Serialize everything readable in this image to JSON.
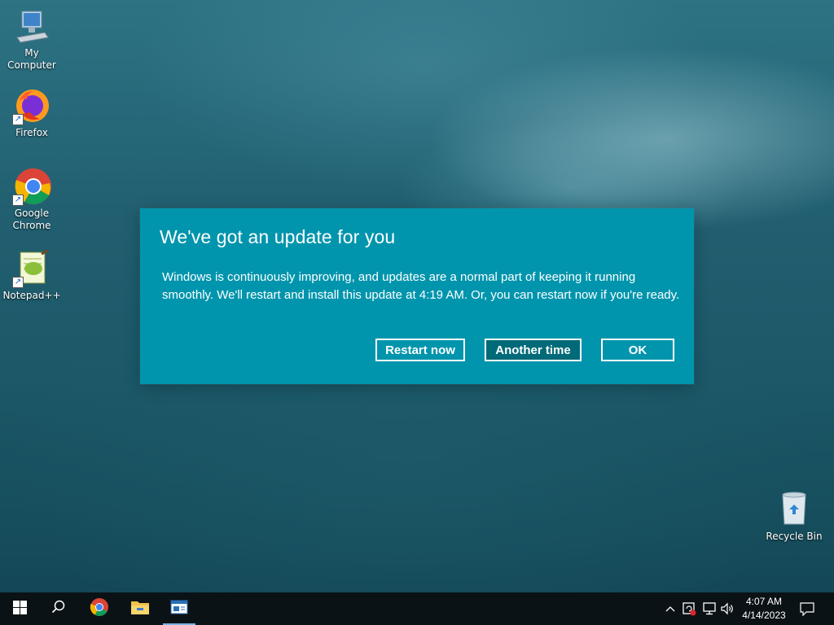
{
  "desktop": {
    "icons": [
      {
        "label": "My Computer"
      },
      {
        "label": "Firefox"
      },
      {
        "label": "Google Chrome"
      },
      {
        "label": "Notepad++"
      },
      {
        "label": "Recycle Bin"
      }
    ]
  },
  "dialog": {
    "title": "We've got an update for you",
    "body": "Windows is continuously improving, and updates are a normal part of keeping it running smoothly. We'll restart and install this update at 4:19 AM. Or, you can restart now if you're ready.",
    "buttons": {
      "restart_now": "Restart now",
      "another_time": "Another time",
      "ok": "OK"
    },
    "background_color": "#0095ad",
    "focused_button_color": "#006a78"
  },
  "taskbar": {
    "pinned": [
      {
        "icon": "windows-start-icon"
      },
      {
        "icon": "search-icon"
      },
      {
        "icon": "chrome-icon"
      },
      {
        "icon": "file-explorer-icon"
      },
      {
        "icon": "app-window-icon",
        "active": true
      }
    ],
    "tray_icons": [
      "chevron-up-icon",
      "update-alert-icon",
      "network-icon",
      "volume-icon"
    ],
    "clock": {
      "time": "4:07 AM",
      "date": "4/14/2023"
    },
    "notification_icon": "action-center-icon"
  }
}
